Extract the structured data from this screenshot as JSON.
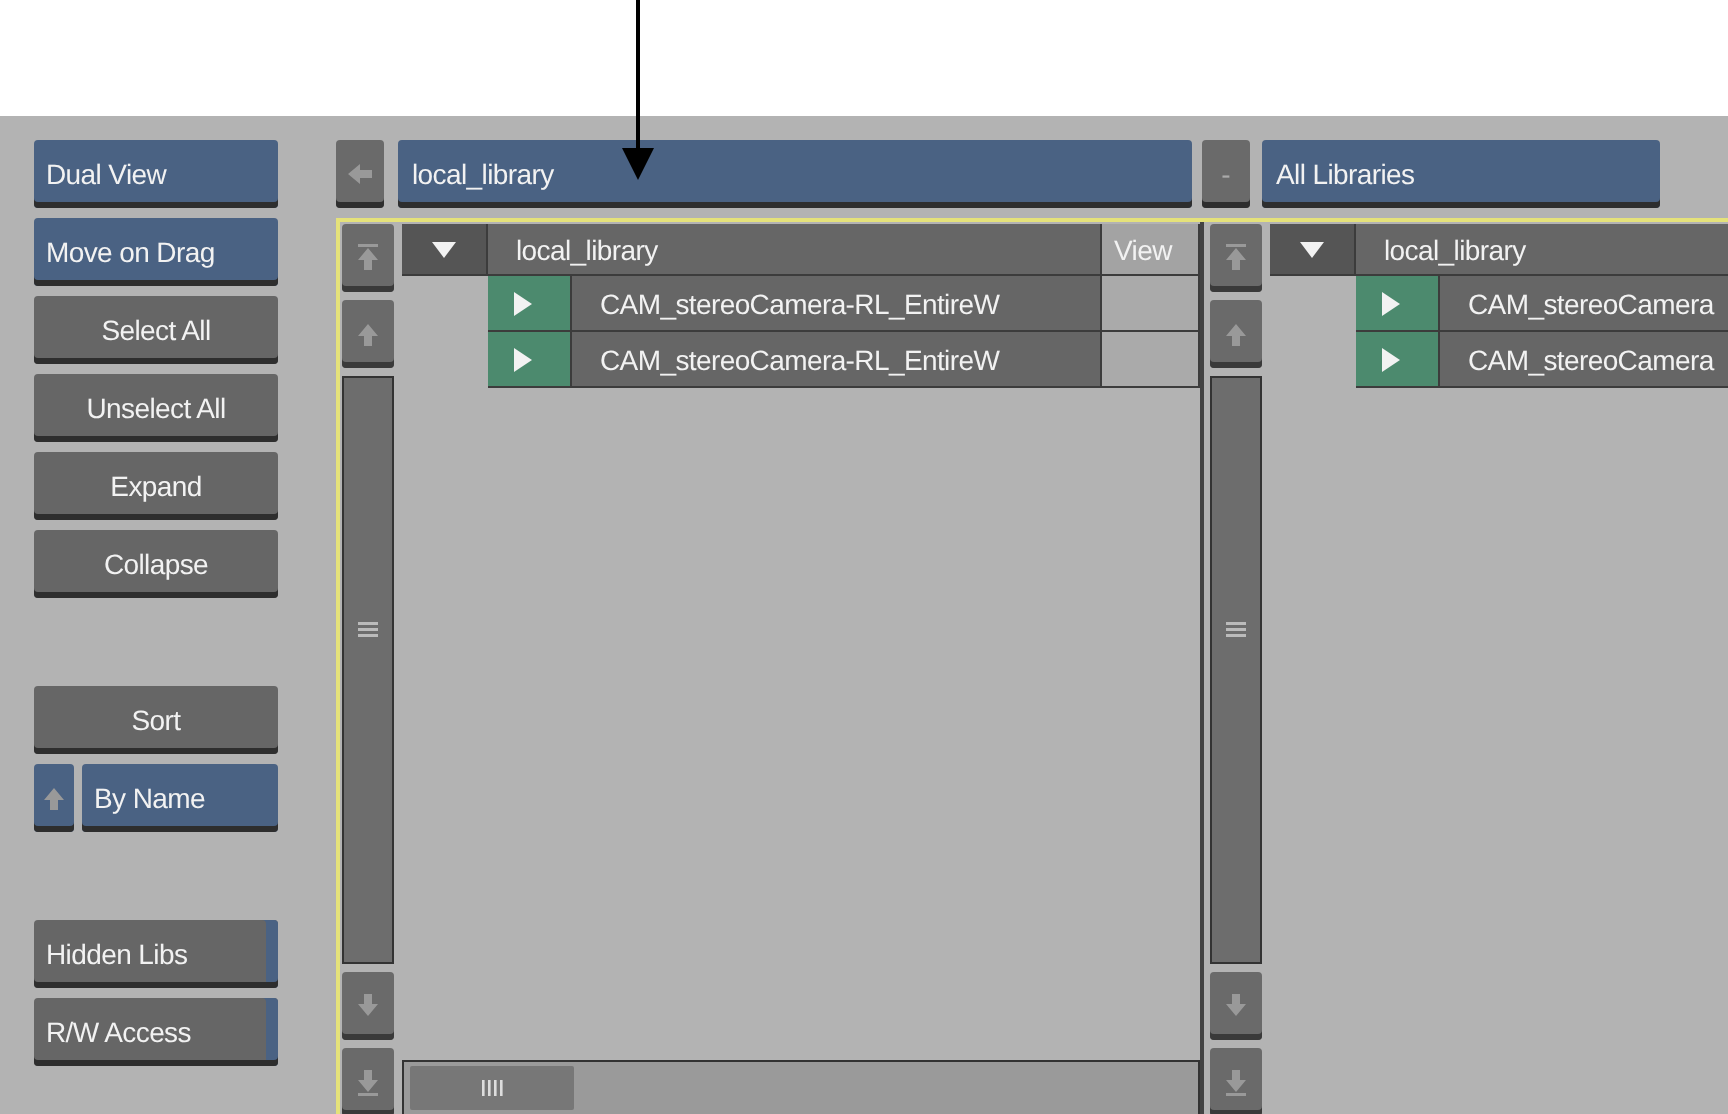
{
  "sidebar": {
    "groups": [
      [
        {
          "label": "Dual View",
          "kind": "toggle",
          "on": true
        },
        {
          "label": "Move on Drag",
          "kind": "toggle",
          "on": true
        },
        {
          "label": "Select All",
          "kind": "action"
        },
        {
          "label": "Unselect All",
          "kind": "action"
        },
        {
          "label": "Expand",
          "kind": "action"
        },
        {
          "label": "Collapse",
          "kind": "action"
        }
      ],
      [
        {
          "label": "Sort",
          "kind": "action"
        },
        {
          "label": "By Name",
          "kind": "sort",
          "on": true
        }
      ],
      [
        {
          "label": "Hidden Libs",
          "kind": "toggle",
          "on": false
        },
        {
          "label": "R/W Access",
          "kind": "toggle",
          "on": false
        }
      ]
    ]
  },
  "browsers": [
    {
      "path": "local_library",
      "header": {
        "expanded": true,
        "name": "local_library",
        "column_2": "View"
      },
      "rows": [
        {
          "name": "CAM_stereoCamera-RL_EntireW",
          "expanded": false
        },
        {
          "name": "CAM_stereoCamera-RL_EntireW",
          "expanded": false
        }
      ]
    },
    {
      "path_button": "-",
      "path": "All Libraries",
      "header": {
        "expanded": true,
        "name": "local_library"
      },
      "rows": [
        {
          "name": "CAM_stereoCamera",
          "expanded": false
        },
        {
          "name": "CAM_stereoCamera",
          "expanded": false
        }
      ]
    }
  ]
}
